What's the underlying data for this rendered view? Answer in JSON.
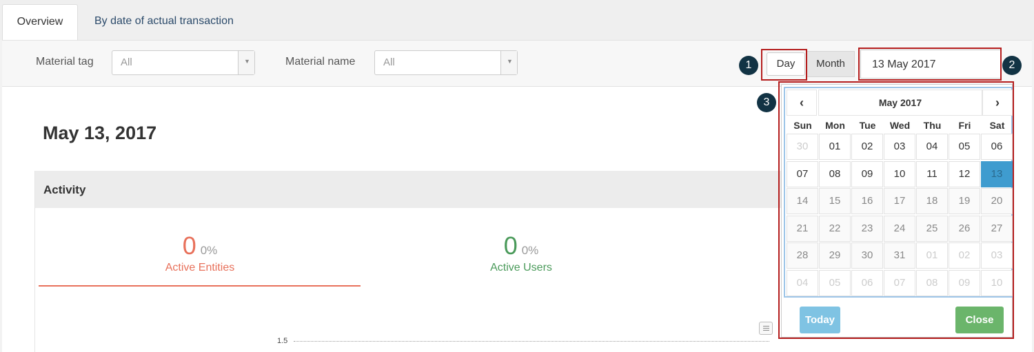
{
  "tabs": [
    {
      "label": "Overview",
      "active": true
    },
    {
      "label": "By date of actual transaction",
      "active": false
    }
  ],
  "filters": {
    "material_tag": {
      "label": "Material tag",
      "value": "All"
    },
    "material_name": {
      "label": "Material name",
      "value": "All"
    }
  },
  "period": {
    "day_label": "Day",
    "month_label": "Month",
    "selected": "Day"
  },
  "date_input": {
    "value": "13 May 2017"
  },
  "markers": [
    "1",
    "2",
    "3"
  ],
  "main": {
    "date_heading": "May 13, 2017",
    "panel_title": "Activity",
    "stats": [
      {
        "value": "0",
        "percent": "0%",
        "label": "Active Entities",
        "color": "#e8705a"
      },
      {
        "value": "0",
        "percent": "0%",
        "label": "Active Users",
        "color": "#4a9a5a"
      }
    ],
    "chart_axis_tick": "1.5"
  },
  "calendar": {
    "title": "May 2017",
    "prev_icon": "chevron-left-icon",
    "next_icon": "chevron-right-icon",
    "weekdays": [
      "Sun",
      "Mon",
      "Tue",
      "Wed",
      "Thu",
      "Fri",
      "Sat"
    ],
    "weeks": [
      [
        "30",
        "01",
        "02",
        "03",
        "04",
        "05",
        "06"
      ],
      [
        "07",
        "08",
        "09",
        "10",
        "11",
        "12",
        "13"
      ],
      [
        "14",
        "15",
        "16",
        "17",
        "18",
        "19",
        "20"
      ],
      [
        "21",
        "22",
        "23",
        "24",
        "25",
        "26",
        "27"
      ],
      [
        "28",
        "29",
        "30",
        "31",
        "01",
        "02",
        "03"
      ],
      [
        "04",
        "05",
        "06",
        "07",
        "08",
        "09",
        "10"
      ]
    ],
    "selected_day": "13",
    "today_label": "Today",
    "close_label": "Close"
  },
  "colors": {
    "annotation": "#b41c1c",
    "selected_day": "#3f9ccf",
    "today_button": "#7fc3e3",
    "close_button": "#6bb56b",
    "entities": "#e8705a",
    "users": "#4a9a5a"
  }
}
